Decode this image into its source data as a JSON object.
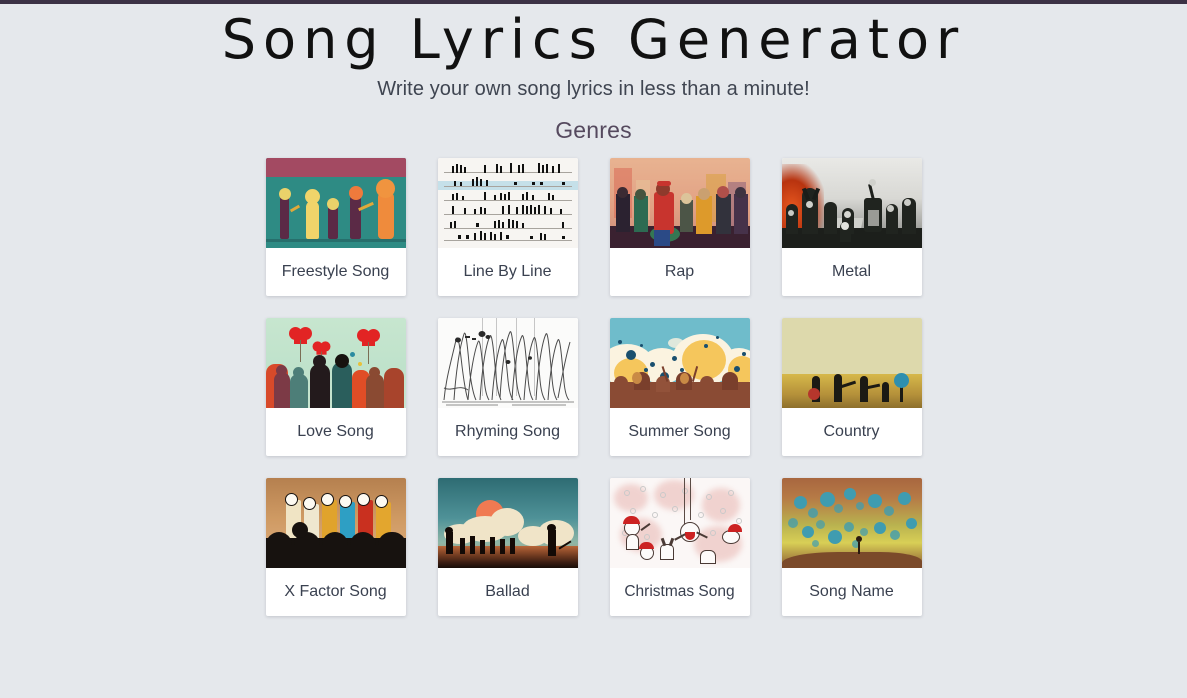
{
  "page": {
    "title": "Song Lyrics Generator",
    "subtitle": "Write your own song lyrics in less than a minute!",
    "section_heading": "Genres",
    "background_color": "#e5e8ec",
    "topbar_color": "#3c3245",
    "heading_color": "#55495e",
    "label_color": "#3a4150"
  },
  "genres": [
    {
      "label": "Freestyle Song",
      "art": "band-of-creatures-teal"
    },
    {
      "label": "Line By Line",
      "art": "sheet-music-staves"
    },
    {
      "label": "Rap",
      "art": "rap-crowd-warm"
    },
    {
      "label": "Metal",
      "art": "dark-misty-figures"
    },
    {
      "label": "Love Song",
      "art": "red-hearts-crowd-mint"
    },
    {
      "label": "Rhyming Song",
      "art": "pencil-scribble-lines"
    },
    {
      "label": "Summer Song",
      "art": "sun-blobs-crowd-sky"
    },
    {
      "label": "Country",
      "art": "wheat-field-silhouettes"
    },
    {
      "label": "X Factor Song",
      "art": "smiley-contestants-stage"
    },
    {
      "label": "Ballad",
      "art": "sunset-clouds-silhouettes"
    },
    {
      "label": "Christmas Song",
      "art": "snow-carolers-sketch"
    },
    {
      "label": "Song Name",
      "art": "teal-balloons-field"
    }
  ]
}
